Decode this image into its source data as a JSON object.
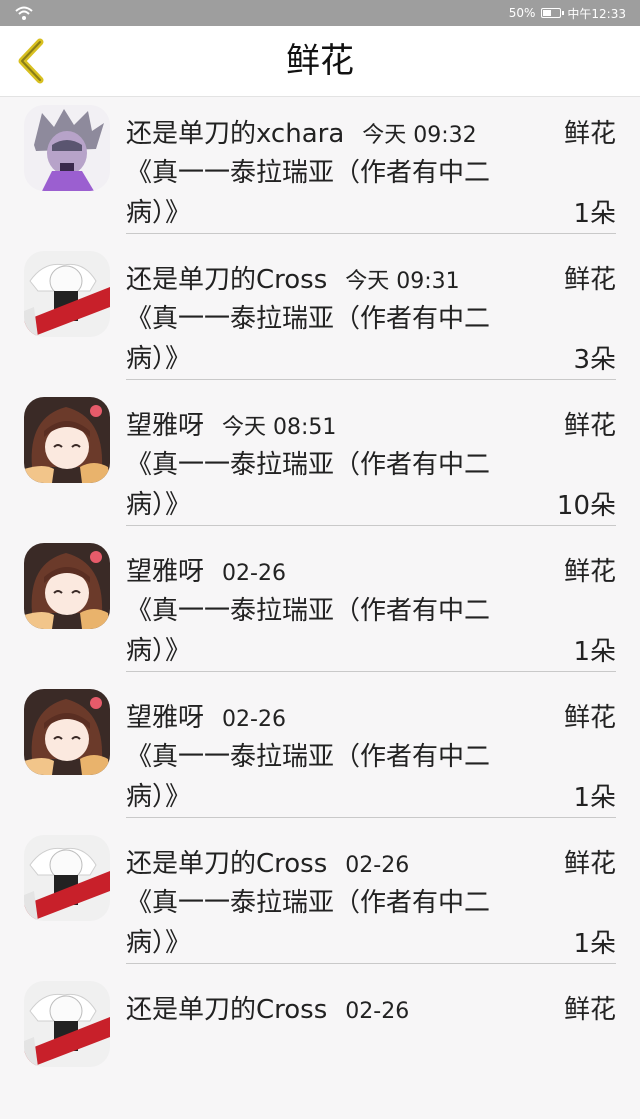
{
  "status_bar": {
    "battery_text": "50%",
    "battery_level": 0.5,
    "time": "中午12:33",
    "icons": [
      "wifi-icon",
      "battery-icon"
    ],
    "color": "#9e9e9e"
  },
  "header": {
    "title": "鲜花",
    "back_icon": "chevron-left-icon",
    "accent": "#d8c020"
  },
  "items": [
    {
      "user": "还是单刀的xchara",
      "time": "今天 09:32",
      "gift": "鲜花",
      "work": "《真一一泰拉瑞亚（作者有中二病）》",
      "count": "1朵",
      "avatar": "purple-hair-character"
    },
    {
      "user": "还是单刀的Cross",
      "time": "今天 09:31",
      "gift": "鲜花",
      "work": "《真一一泰拉瑞亚（作者有中二病）》",
      "count": "3朵",
      "avatar": "skeleton-red-scarf"
    },
    {
      "user": "望雅呀",
      "time": "今天 08:51",
      "gift": "鲜花",
      "work": "《真一一泰拉瑞亚（作者有中二病）》",
      "count": "10朵",
      "avatar": "brown-hair-girl"
    },
    {
      "user": "望雅呀",
      "time": "02-26",
      "gift": "鲜花",
      "work": "《真一一泰拉瑞亚（作者有中二病）》",
      "count": "1朵",
      "avatar": "brown-hair-girl"
    },
    {
      "user": "望雅呀",
      "time": "02-26",
      "gift": "鲜花",
      "work": "《真一一泰拉瑞亚（作者有中二病）》",
      "count": "1朵",
      "avatar": "brown-hair-girl"
    },
    {
      "user": "还是单刀的Cross",
      "time": "02-26",
      "gift": "鲜花",
      "work": "《真一一泰拉瑞亚（作者有中二病）》",
      "count": "1朵",
      "avatar": "skeleton-red-scarf"
    },
    {
      "user": "还是单刀的Cross",
      "time": "02-26",
      "gift": "鲜花",
      "work": "",
      "count": "",
      "avatar": "skeleton-red-scarf"
    }
  ]
}
